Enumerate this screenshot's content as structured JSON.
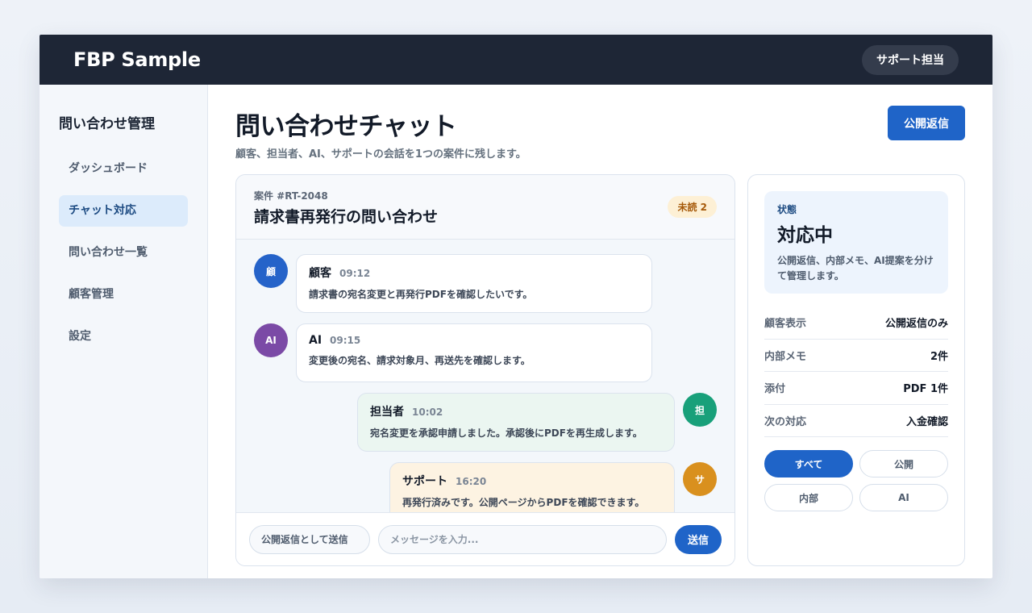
{
  "header": {
    "brand": "FBP Sample",
    "role": "サポート担当"
  },
  "sidebar": {
    "title": "問い合わせ管理",
    "items": [
      {
        "label": "ダッシュボード"
      },
      {
        "label": "チャット対応"
      },
      {
        "label": "問い合わせ一覧"
      },
      {
        "label": "顧客管理"
      },
      {
        "label": "設定"
      }
    ]
  },
  "main": {
    "title": "問い合わせチャット",
    "subtitle": "顧客、担当者、AI、サポートの会話を1つの案件に残します。",
    "reply_button": "公開返信"
  },
  "chat": {
    "case_id": "案件 #RT-2048",
    "case_title": "請求書再発行の問い合わせ",
    "unread": "未読 2",
    "messages": [
      {
        "avatar": "顧",
        "sender": "顧客",
        "time": "09:12",
        "text": "請求書の宛名変更と再発行PDFを確認したいです。",
        "color": "#2563c9"
      },
      {
        "avatar": "AI",
        "sender": "AI",
        "time": "09:15",
        "text": "変更後の宛名、請求対象月、再送先を確認します。",
        "color": "#7b4aa6"
      },
      {
        "avatar": "担",
        "sender": "担当者",
        "time": "10:02",
        "text": "宛名変更を承認申請しました。承認後にPDFを再生成します。",
        "color": "#18a07a",
        "bubble": "#ebf6f1"
      },
      {
        "avatar": "サ",
        "sender": "サポート",
        "time": "16:20",
        "text": "再発行済みです。公開ページからPDFを確認できます。",
        "color": "#d9901e",
        "bubble": "#fdf3e2"
      }
    ],
    "composer": {
      "mode": "公開返信として送信",
      "placeholder": "メッセージを入力...",
      "send": "送信"
    }
  },
  "panel": {
    "status_label": "状態",
    "status_value": "対応中",
    "status_desc": "公開返信、内部メモ、AI提案を分けて管理します。",
    "rows": [
      {
        "key": "顧客表示",
        "value": "公開返信のみ"
      },
      {
        "key": "内部メモ",
        "value": "2件"
      },
      {
        "key": "添付",
        "value": "PDF 1件"
      },
      {
        "key": "次の対応",
        "value": "入金確認"
      }
    ],
    "filters": [
      {
        "label": "すべて"
      },
      {
        "label": "公開"
      },
      {
        "label": "内部"
      },
      {
        "label": "AI"
      }
    ]
  }
}
